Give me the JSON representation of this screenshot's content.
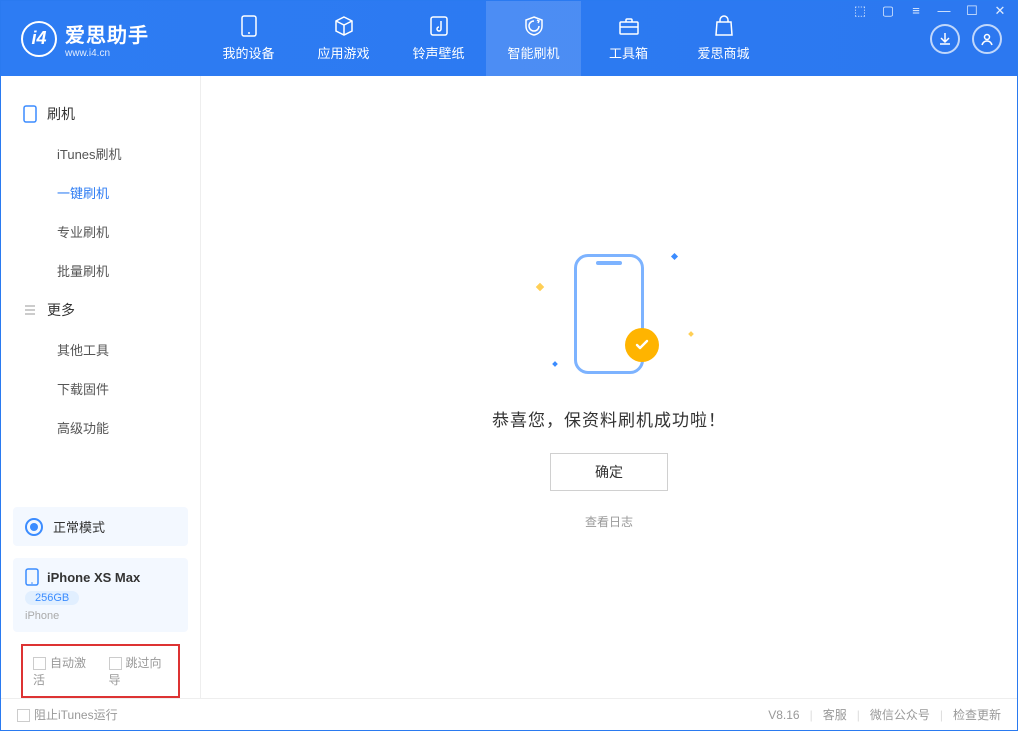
{
  "app": {
    "name": "爱思助手",
    "domain": "www.i4.cn"
  },
  "nav": {
    "device": "我的设备",
    "apps": "应用游戏",
    "ringtones": "铃声壁纸",
    "flash": "智能刷机",
    "toolbox": "工具箱",
    "store": "爱思商城"
  },
  "sidebar": {
    "flash_header": "刷机",
    "items": {
      "itunes": "iTunes刷机",
      "onekey": "一键刷机",
      "pro": "专业刷机",
      "batch": "批量刷机"
    },
    "more_header": "更多",
    "more": {
      "other": "其他工具",
      "firmware": "下载固件",
      "advanced": "高级功能"
    }
  },
  "mode": {
    "label": "正常模式"
  },
  "device": {
    "name": "iPhone XS Max",
    "capacity": "256GB",
    "type": "iPhone"
  },
  "options": {
    "auto_activate": "自动激活",
    "skip_setup": "跳过向导"
  },
  "result": {
    "message": "恭喜您，保资料刷机成功啦！",
    "ok": "确定",
    "view_log": "查看日志"
  },
  "footer": {
    "block_itunes": "阻止iTunes运行",
    "version": "V8.16",
    "support": "客服",
    "wechat": "微信公众号",
    "check_update": "检查更新"
  }
}
